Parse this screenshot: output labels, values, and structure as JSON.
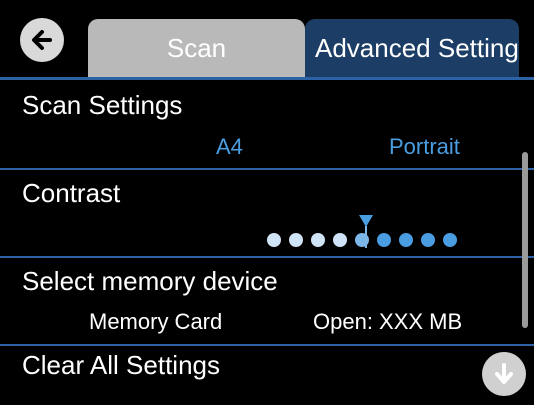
{
  "tabs": [
    {
      "label": "Scan"
    },
    {
      "label": "Advanced Settings"
    }
  ],
  "icons": {
    "back": "back-arrow-icon",
    "down": "down-arrow-icon"
  },
  "settings": {
    "scan_settings": {
      "title": "Scan Settings",
      "size": "A4",
      "orientation": "Portrait"
    },
    "contrast": {
      "title": "Contrast",
      "level_count": 9,
      "selected_index": 4
    },
    "memory": {
      "title": "Select memory device",
      "device": "Memory Card",
      "status": "Open: XXX MB"
    },
    "clear": {
      "title": "Clear All Settings"
    }
  },
  "colors": {
    "accent": "#2b63a6",
    "value_blue": "#4a9de0",
    "active_tab": "#1c3e66",
    "inactive_tab": "#b9b9b9"
  }
}
